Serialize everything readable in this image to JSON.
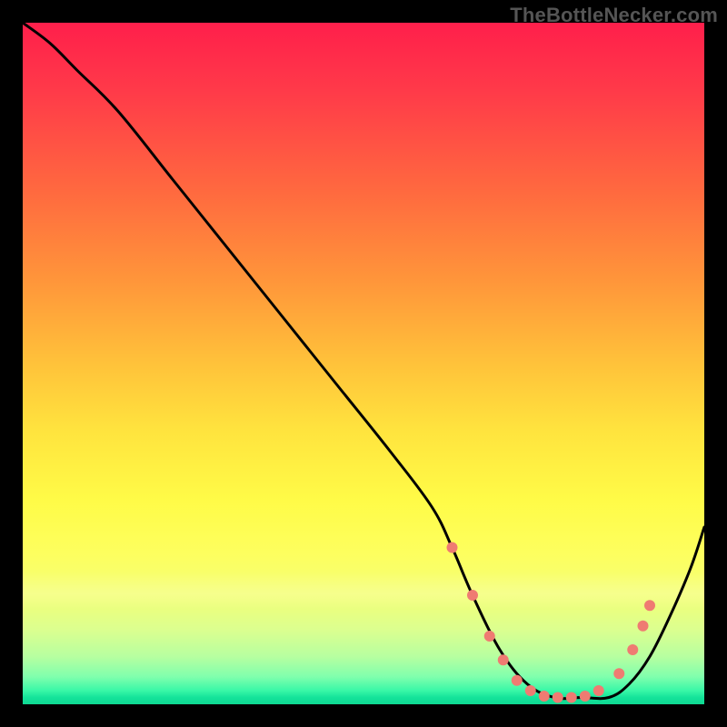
{
  "branding": {
    "watermark": "TheBottleNecker.com"
  },
  "chart_data": {
    "type": "line",
    "title": "",
    "xlabel": "",
    "ylabel": "",
    "xlim": [
      0,
      100
    ],
    "ylim": [
      0,
      100
    ],
    "background_gradient_stops": [
      {
        "pos": 0,
        "color": "#ff1f4b"
      },
      {
        "pos": 25,
        "color": "#ff6a3f"
      },
      {
        "pos": 50,
        "color": "#ffc23a"
      },
      {
        "pos": 70,
        "color": "#fffb47"
      },
      {
        "pos": 93,
        "color": "#b7ffa0"
      },
      {
        "pos": 100,
        "color": "#0fd892"
      }
    ],
    "series": [
      {
        "name": "bottleneck-curve",
        "color": "#000000",
        "x": [
          0,
          4,
          8,
          14,
          22,
          30,
          38,
          46,
          54,
          60,
          63,
          66,
          70,
          74,
          78,
          82,
          86,
          89,
          92,
          95,
          98,
          100
        ],
        "y": [
          100,
          97,
          93,
          87,
          77,
          67,
          57,
          47,
          37,
          29,
          23,
          16,
          8,
          3,
          1,
          1,
          1,
          3,
          7,
          13,
          20,
          26
        ]
      }
    ],
    "markers": {
      "name": "sweet-spot-dots",
      "color": "#ef7b72",
      "radius": 6,
      "points": [
        {
          "x": 63.0,
          "y": 23.0
        },
        {
          "x": 66.0,
          "y": 16.0
        },
        {
          "x": 68.5,
          "y": 10.0
        },
        {
          "x": 70.5,
          "y": 6.5
        },
        {
          "x": 72.5,
          "y": 3.5
        },
        {
          "x": 74.5,
          "y": 2.0
        },
        {
          "x": 76.5,
          "y": 1.2
        },
        {
          "x": 78.5,
          "y": 1.0
        },
        {
          "x": 80.5,
          "y": 1.0
        },
        {
          "x": 82.5,
          "y": 1.2
        },
        {
          "x": 84.5,
          "y": 2.0
        },
        {
          "x": 87.5,
          "y": 4.5
        },
        {
          "x": 89.5,
          "y": 8.0
        },
        {
          "x": 91.0,
          "y": 11.5
        },
        {
          "x": 92.0,
          "y": 14.5
        }
      ]
    }
  }
}
